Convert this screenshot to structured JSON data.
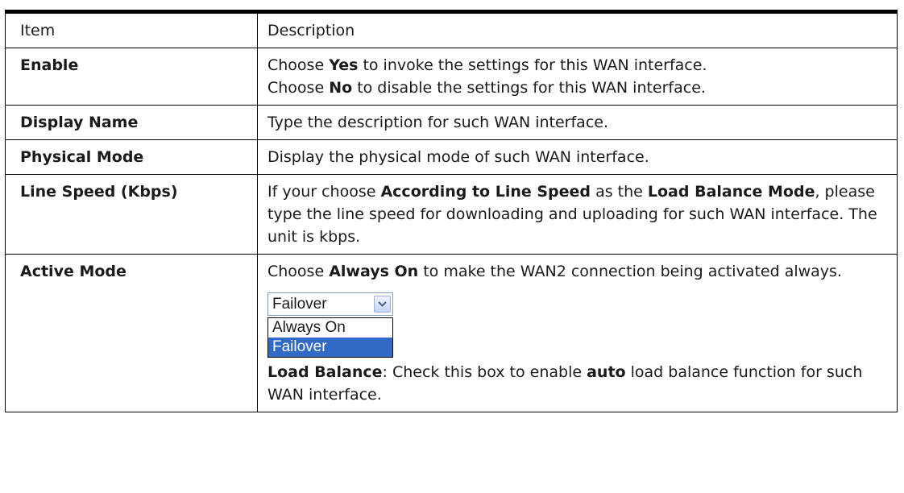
{
  "header": {
    "item": "Item",
    "description": "Description"
  },
  "rows": {
    "enable": {
      "item": "Enable",
      "l1_a": "Choose ",
      "l1_b": "Yes",
      "l1_c": " to invoke the settings for this WAN interface.",
      "l2_a": "Choose ",
      "l2_b": "No",
      "l2_c": " to disable the settings for this WAN interface."
    },
    "display_name": {
      "item": "Display Name",
      "text": "Type the description for such WAN interface."
    },
    "physical_mode": {
      "item": "Physical Mode",
      "text": "Display the physical mode of such WAN interface."
    },
    "line_speed": {
      "item": "Line Speed (Kbps)",
      "t1": "If your choose ",
      "b1": "According to Line Speed",
      "t2": " as the ",
      "b2": "Load Balance Mode",
      "t3": ", please type the line speed for downloading and uploading for such WAN interface. The unit is kbps."
    },
    "active_mode": {
      "item": "Active Mode",
      "t1": "Choose ",
      "b1": "Always On",
      "t2": " to make the WAN2 connection being activated always.",
      "select": {
        "value": "Failover",
        "options": [
          "Always On",
          "Failover"
        ],
        "highlighted": "Failover"
      },
      "lb_b": "Load Balance",
      "lb_t1": ": Check this box to enable ",
      "lb_b2": "auto",
      "lb_t2": " load balance function for such WAN interface."
    }
  },
  "colors": {
    "highlight": "#316ac5",
    "select_border": "#7f9db9"
  }
}
